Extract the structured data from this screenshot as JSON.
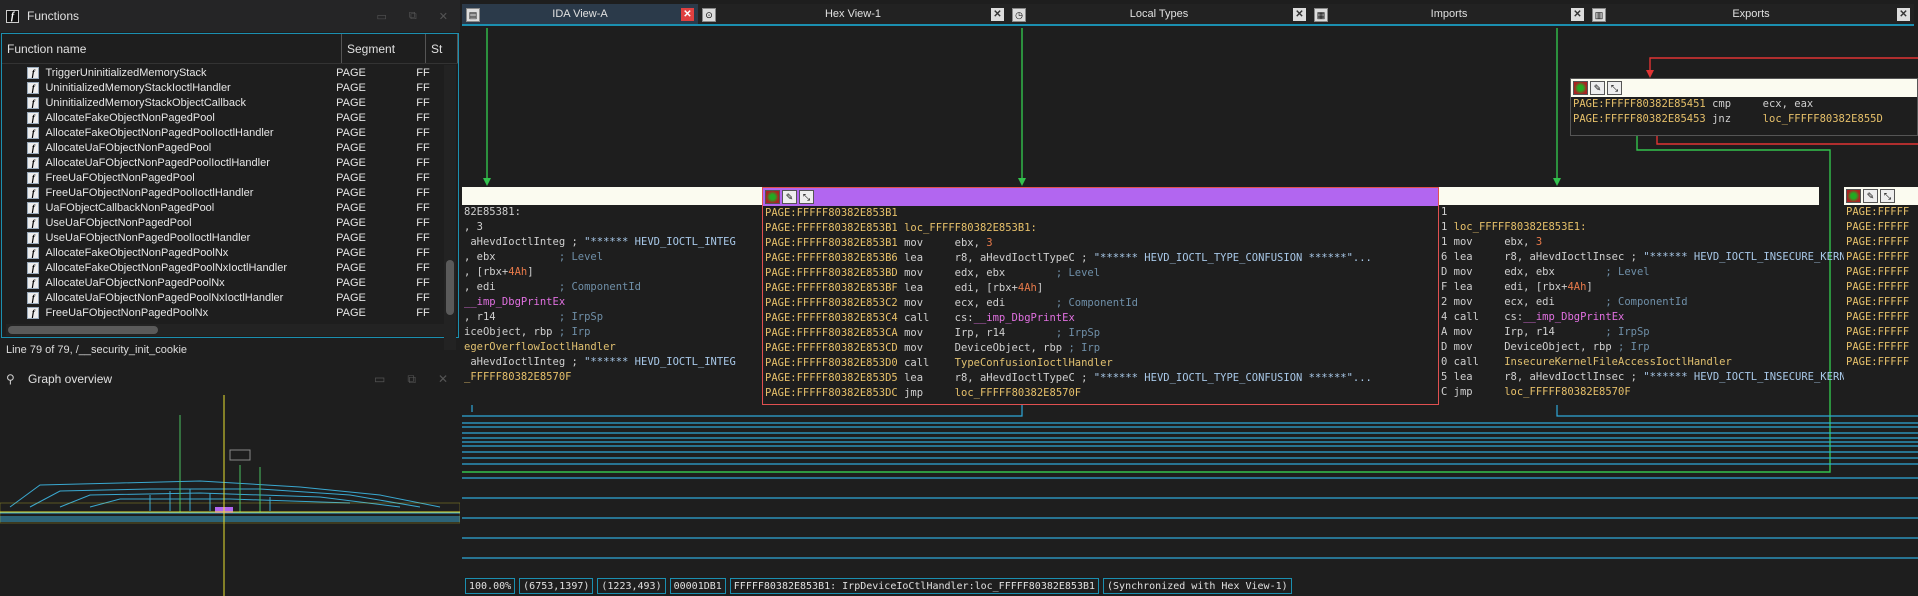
{
  "functions_panel": {
    "title": "Functions",
    "columns": [
      "Function name",
      "Segment",
      "St"
    ],
    "rows": [
      {
        "name": "TriggerUninitializedMemoryStack",
        "segment": "PAGE",
        "start": "FF"
      },
      {
        "name": "UninitializedMemoryStackIoctlHandler",
        "segment": "PAGE",
        "start": "FF"
      },
      {
        "name": "UninitializedMemoryStackObjectCallback",
        "segment": "PAGE",
        "start": "FF"
      },
      {
        "name": "AllocateFakeObjectNonPagedPool",
        "segment": "PAGE",
        "start": "FF"
      },
      {
        "name": "AllocateFakeObjectNonPagedPoolIoctlHandler",
        "segment": "PAGE",
        "start": "FF"
      },
      {
        "name": "AllocateUaFObjectNonPagedPool",
        "segment": "PAGE",
        "start": "FF"
      },
      {
        "name": "AllocateUaFObjectNonPagedPoolIoctlHandler",
        "segment": "PAGE",
        "start": "FF"
      },
      {
        "name": "FreeUaFObjectNonPagedPool",
        "segment": "PAGE",
        "start": "FF"
      },
      {
        "name": "FreeUaFObjectNonPagedPoolIoctlHandler",
        "segment": "PAGE",
        "start": "FF"
      },
      {
        "name": "UaFObjectCallbackNonPagedPool",
        "segment": "PAGE",
        "start": "FF"
      },
      {
        "name": "UseUaFObjectNonPagedPool",
        "segment": "PAGE",
        "start": "FF"
      },
      {
        "name": "UseUaFObjectNonPagedPoolIoctlHandler",
        "segment": "PAGE",
        "start": "FF"
      },
      {
        "name": "AllocateFakeObjectNonPagedPoolNx",
        "segment": "PAGE",
        "start": "FF"
      },
      {
        "name": "AllocateFakeObjectNonPagedPoolNxIoctlHandler",
        "segment": "PAGE",
        "start": "FF"
      },
      {
        "name": "AllocateUaFObjectNonPagedPoolNx",
        "segment": "PAGE",
        "start": "FF"
      },
      {
        "name": "AllocateUaFObjectNonPagedPoolNxIoctlHandler",
        "segment": "PAGE",
        "start": "FF"
      },
      {
        "name": "FreeUaFObjectNonPagedPoolNx",
        "segment": "PAGE",
        "start": "FF"
      }
    ],
    "status": "Line 79 of 79, /__security_init_cookie"
  },
  "graph_overview": {
    "title": "Graph overview"
  },
  "tabs": [
    {
      "label": "IDA View-A",
      "icon": "ida-view-icon",
      "active": true
    },
    {
      "label": "Hex View-1",
      "icon": "hex-view-icon",
      "active": false
    },
    {
      "label": "Local Types",
      "icon": "local-types-icon",
      "active": false
    },
    {
      "label": "Imports",
      "icon": "imports-icon",
      "active": false
    },
    {
      "label": "Exports",
      "icon": "exports-icon",
      "active": false
    }
  ],
  "top_node": {
    "lines": [
      "PAGE:FFFFF80382E85451 cmp     ecx, eax",
      "PAGE:FFFFF80382E85453 jnz     loc_FFFFF80382E855D"
    ]
  },
  "left_node": {
    "lines": [
      "82E85381:",
      ", 3",
      " aHevdIoctlInteg ; \"****** HEVD_IOCTL_INTEG",
      ", ebx          ; Level",
      ", [rbx+4Ah]",
      ", edi          ; ComponentId",
      "__imp_DbgPrintEx",
      ", r14          ; IrpSp",
      "iceObject, rbp ; Irp",
      "egerOverflowIoctlHandler",
      " aHevdIoctlInteg ; \"****** HEVD_IOCTL_INTEG",
      "_FFFFF80382E8570F"
    ]
  },
  "center_node": {
    "lines": [
      "PAGE:FFFFF80382E853B1",
      "PAGE:FFFFF80382E853B1 loc_FFFFF80382E853B1:",
      "PAGE:FFFFF80382E853B1 mov     ebx, 3",
      "PAGE:FFFFF80382E853B6 lea     r8, aHevdIoctlTypeC ; \"****** HEVD_IOCTL_TYPE_CONFUSION ******\"...",
      "PAGE:FFFFF80382E853BD mov     edx, ebx        ; Level",
      "PAGE:FFFFF80382E853BF lea     edi, [rbx+4Ah]",
      "PAGE:FFFFF80382E853C2 mov     ecx, edi        ; ComponentId",
      "PAGE:FFFFF80382E853C4 call    cs:__imp_DbgPrintEx",
      "PAGE:FFFFF80382E853CA mov     Irp, r14        ; IrpSp",
      "PAGE:FFFFF80382E853CD mov     DeviceObject, rbp ; Irp",
      "PAGE:FFFFF80382E853D0 call    TypeConfusionIoctlHandler",
      "PAGE:FFFFF80382E853D5 lea     r8, aHevdIoctlTypeC ; \"****** HEVD_IOCTL_TYPE_CONFUSION ******\"...",
      "PAGE:FFFFF80382E853DC jmp     loc_FFFFF80382E8570F"
    ]
  },
  "right_node": {
    "lines": [
      "1",
      "1 loc_FFFFF80382E853E1:",
      "1 mov     ebx, 3",
      "6 lea     r8, aHevdIoctlInsec ; \"****** HEVD_IOCTL_INSECURE_KERNEL_F",
      "D mov     edx, ebx        ; Level",
      "F lea     edi, [rbx+4Ah]",
      "2 mov     ecx, edi        ; ComponentId",
      "4 call    cs:__imp_DbgPrintEx",
      "A mov     Irp, r14        ; IrpSp",
      "D mov     DeviceObject, rbp ; Irp",
      "0 call    InsecureKernelFileAccessIoctlHandler",
      "5 lea     r8, aHevdIoctlInsec ; \"****** HEVD_IOCTL_INSECURE_KERNEL_F",
      "C jmp     loc_FFFFF80382E8570F"
    ]
  },
  "far_right_node": {
    "lines": [
      "PAGE:FFFFF",
      "PAGE:FFFFF",
      "PAGE:FFFFF",
      "PAGE:FFFFF",
      "PAGE:FFFFF",
      "PAGE:FFFFF",
      "PAGE:FFFFF",
      "PAGE:FFFFF",
      "PAGE:FFFFF",
      "PAGE:FFFFF",
      "PAGE:FFFFF"
    ]
  },
  "status_bar": {
    "zoom": "100.00%",
    "coords": "(6753,1397)",
    "cursor": "(1223,493)",
    "offset": "00001DB1",
    "location": "FFFFF80382E853B1: IrpDeviceIoCtlHandler:loc_FFFFF80382E853B1",
    "sync": "(Synchronized with Hex View-1)"
  },
  "colors": {
    "accent": "#1b8fb0",
    "selected_node_header": "#b266f0",
    "selected_node_border": "#e05050",
    "edge_green": "#33c24d",
    "edge_blue": "#2fa8d8",
    "edge_red": "#e03333",
    "annotation_arrow": "#e83333"
  }
}
